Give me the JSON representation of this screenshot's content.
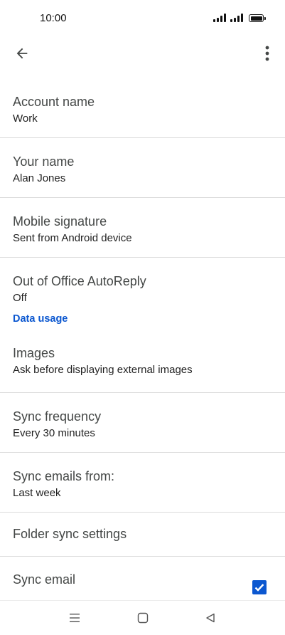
{
  "status_bar": {
    "time": "10:00"
  },
  "app_bar": {
    "back_icon": "arrow-back-icon",
    "more_icon": "more-vert-icon"
  },
  "settings": {
    "account_name": {
      "title": "Account name",
      "summary": "Work"
    },
    "your_name": {
      "title": "Your name",
      "summary": "Alan Jones"
    },
    "mobile_signature": {
      "title": "Mobile signature",
      "summary": "Sent from Android device"
    },
    "out_of_office": {
      "title": "Out of Office AutoReply",
      "summary": "Off"
    },
    "data_usage_header": "Data usage",
    "images": {
      "title": "Images",
      "summary": "Ask before displaying external images"
    },
    "sync_frequency": {
      "title": "Sync frequency",
      "summary": "Every 30 minutes"
    },
    "sync_emails_from": {
      "title": "Sync emails from:",
      "summary": "Last week"
    },
    "folder_sync": {
      "title": "Folder sync settings"
    },
    "sync_email": {
      "title": "Sync email",
      "checked": true
    }
  },
  "colors": {
    "accent": "#0b57d0",
    "divider": "#dcdcdc"
  },
  "nav_bar": {
    "icons": [
      "menu-icon",
      "home-icon",
      "back-triangle-icon"
    ]
  }
}
